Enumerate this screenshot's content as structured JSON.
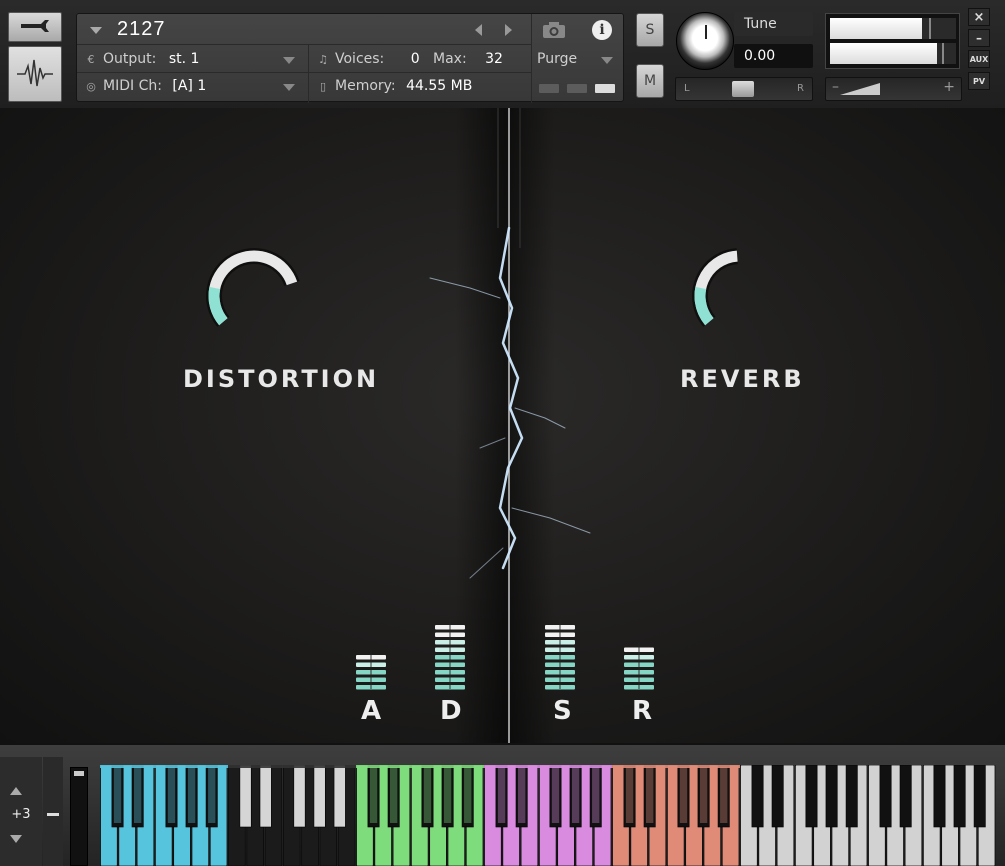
{
  "header": {
    "instrument_name": "2127",
    "output_label": "Output:",
    "output_value": "st. 1",
    "voices_label": "Voices:",
    "voices_value": "0",
    "max_label": "Max:",
    "max_value": "32",
    "purge_label": "Purge",
    "midi_label": "MIDI Ch:",
    "midi_value": "[A]  1",
    "memory_label": "Memory:",
    "memory_value": "44.55 MB",
    "solo_label": "S",
    "mute_label": "M",
    "tune_label": "Tune",
    "tune_value": "0.00",
    "pan_left": "L",
    "pan_right": "R",
    "vol_minus": "–",
    "vol_plus": "+",
    "close_label": "×",
    "minimize_label": "–",
    "aux_label": "AUX",
    "pv_label": "PV"
  },
  "effects": {
    "distortion_label": "DISTORTION",
    "distortion_level": 0.72,
    "reverb_label": "REVERB",
    "reverb_level": 0.45,
    "accent_color": "#7fe0cf"
  },
  "envelope": {
    "labels": [
      "A",
      "D",
      "S",
      "R"
    ],
    "levels": [
      0.35,
      0.65,
      0.65,
      0.45
    ]
  },
  "keyboard": {
    "octave_value": "+3",
    "zones": [
      {
        "color": "#56c4dd",
        "octaves": 1
      },
      {
        "color": "#1a1a1a",
        "octaves": 1
      },
      {
        "color": "#7fdc7c",
        "octaves": 1
      },
      {
        "color": "#d98be0",
        "octaves": 1
      },
      {
        "color": "#e08b78",
        "octaves": 1
      },
      {
        "color": "#d2d2d2",
        "octaves": 2
      }
    ]
  },
  "icons": [
    "wrench-icon",
    "waveform-icon",
    "dropdown-arrow-icon",
    "prev-arrow-icon",
    "next-arrow-icon",
    "camera-icon",
    "info-icon",
    "output-icon",
    "midi-icon",
    "voices-icon",
    "memory-icon"
  ]
}
